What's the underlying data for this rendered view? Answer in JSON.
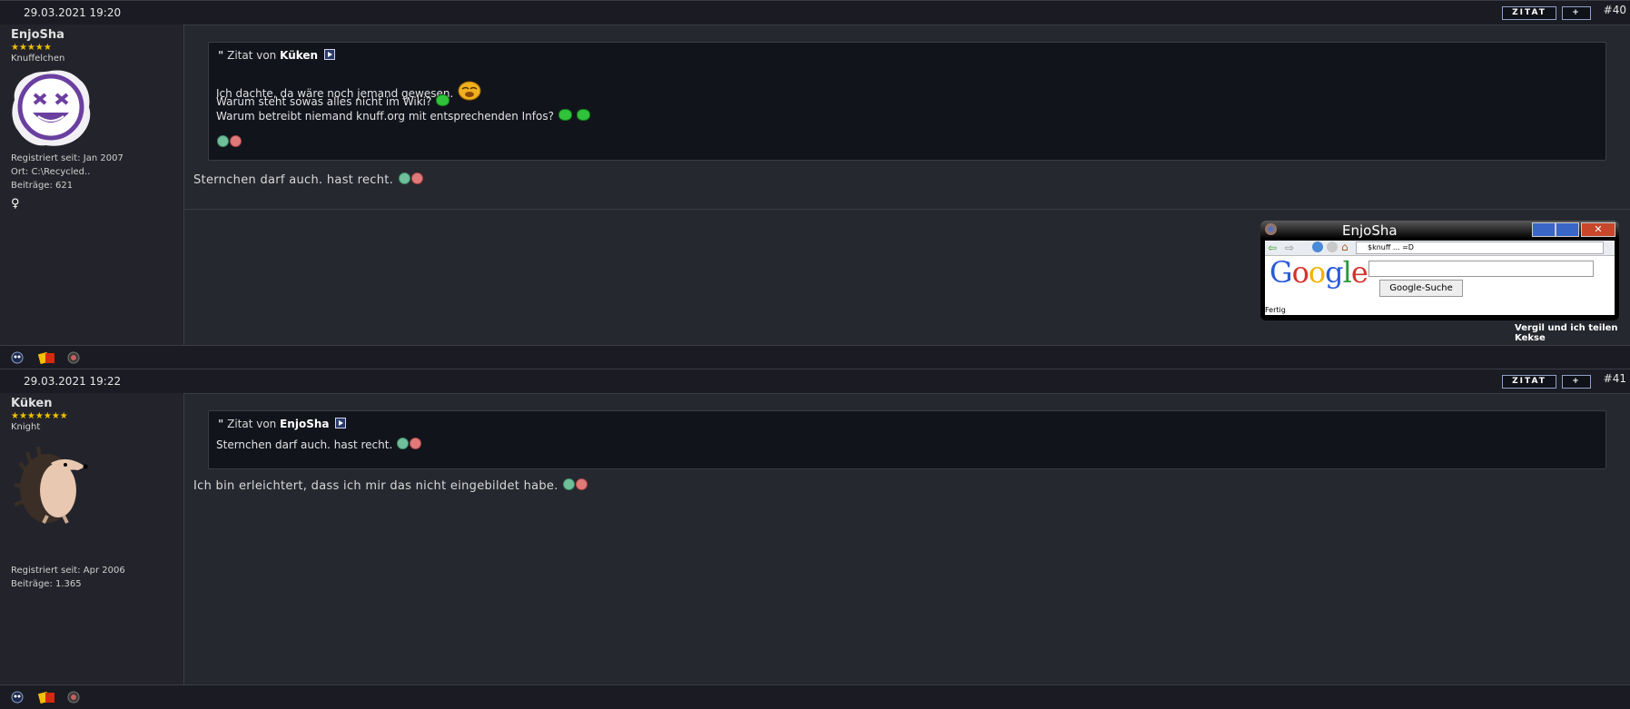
{
  "posts": [
    {
      "date": "29.03.2021 19:20",
      "number": "#40",
      "quote_label": "ZITAT",
      "plus_label": "+",
      "user": {
        "name": "EnjoSha",
        "stars": "★★★★★",
        "rank": "Knuffelchen",
        "registered": "Registriert seit: Jan 2007",
        "location": "Ort: C:\\Recycled..",
        "posts": "Beiträge: 621",
        "gender_icon": "♀"
      },
      "quote": {
        "prefix": "Zitat von",
        "author": "Küken",
        "lines": [
          "Ich dachte, da wäre noch jemand gewesen.",
          "Warum steht sowas alles nicht im Wiki?",
          "Warum betreibt niemand knuff.org mit entsprechenden Infos?"
        ]
      },
      "message": "Sternchen darf auch. hast recht.",
      "signature": {
        "window_title": "EnjoSha",
        "address": "$knuff ... =D",
        "google_button": "Google-Suche",
        "status": "Fertig",
        "caption": "Vergil und ich teilen Kekse"
      }
    },
    {
      "date": "29.03.2021 19:22",
      "number": "#41",
      "quote_label": "ZITAT",
      "plus_label": "+",
      "user": {
        "name": "Küken",
        "stars": "★★★★★★★",
        "rank": "Knight",
        "registered": "Registriert seit: Apr 2006",
        "posts": "Beiträge: 1.365"
      },
      "quote": {
        "prefix": "Zitat von",
        "author": "EnjoSha",
        "lines": [
          "Sternchen darf auch. hast recht."
        ]
      },
      "message": "Ich bin erleichtert, dass ich mir das nicht eingebildet habe."
    }
  ]
}
